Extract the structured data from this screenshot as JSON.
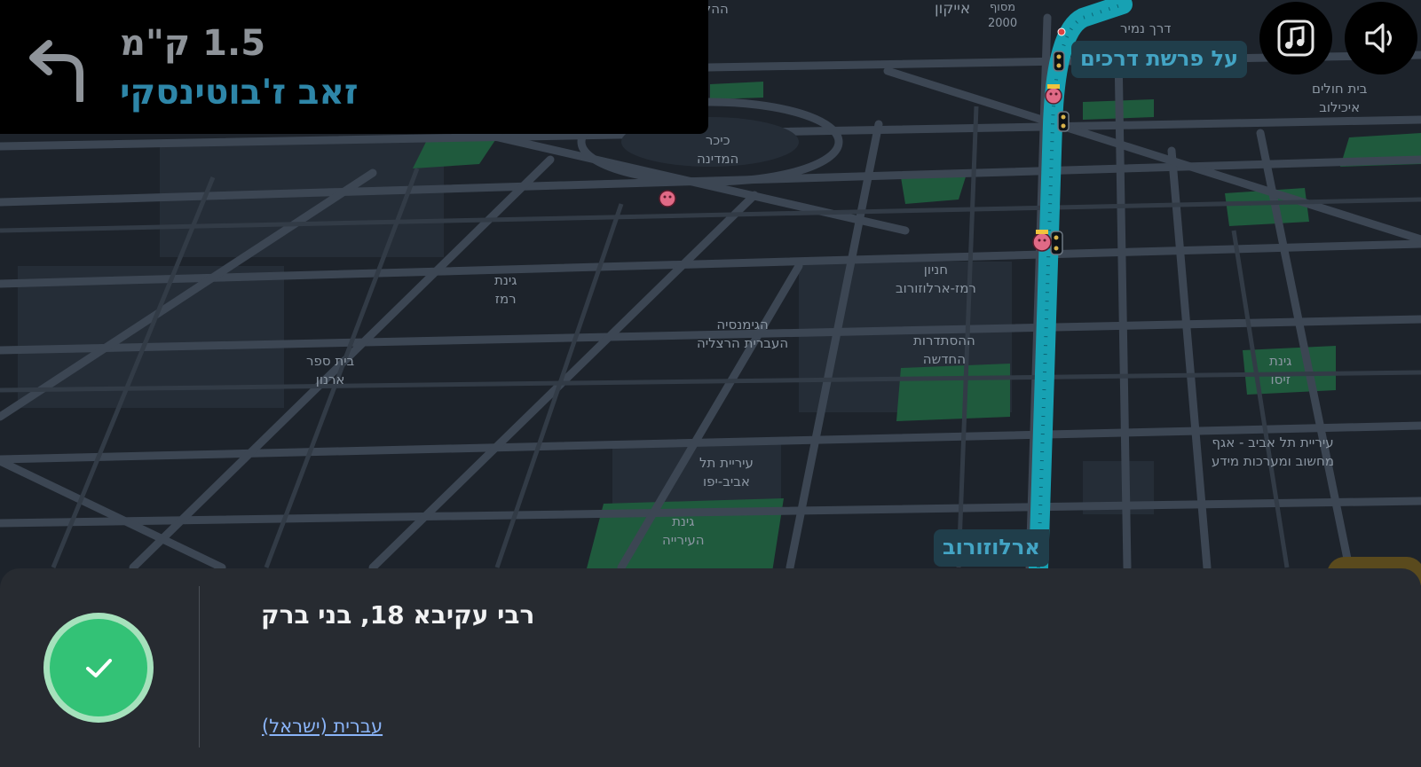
{
  "instruction": {
    "distance": "1.5 ק\"מ",
    "street": "זאב ז'בוטינסקי",
    "turn_icon": "turn-left-arrow-icon"
  },
  "controls": {
    "music_icon": "music-note-icon",
    "sound_icon": "speaker-icon"
  },
  "map": {
    "labels": {
      "l1": "ההלכה",
      "l2": "אייקון",
      "l3": "מסוף\n2000",
      "l4": "דרך נמיר",
      "l5": "בית חולים\nאיכילוב",
      "l6": "כיכר\nהמדינה",
      "l7": "גינת\nרמז",
      "l8": "חניון\nרמז-ארלוזורוב",
      "l9": "הגימנסיה\nהעברית הרצליה",
      "l10": "ההסתדרות\nהחדשה",
      "l11": "בית ספר\nארנון",
      "l12": "גינת\nזיסו",
      "l13": "עיריית תל אביב - אגף\nמחשוב ומערכות מידע",
      "l14": "עיריית תל\nאביב-יפו",
      "l15": "גינת\nהעירייה"
    },
    "street_labels": {
      "crossroad": "על פרשת דרכים",
      "arlozorov": "ארלוזורוב"
    },
    "colors": {
      "background": "#1d232b",
      "road": "#3c4653",
      "park": "#1f5a3d",
      "route": "#1a9aad"
    }
  },
  "bottom": {
    "destination": "רבי עקיבא 18, בני ברק",
    "language_link": "עברית (ישראל)",
    "status_icon": "checkmark-icon"
  }
}
